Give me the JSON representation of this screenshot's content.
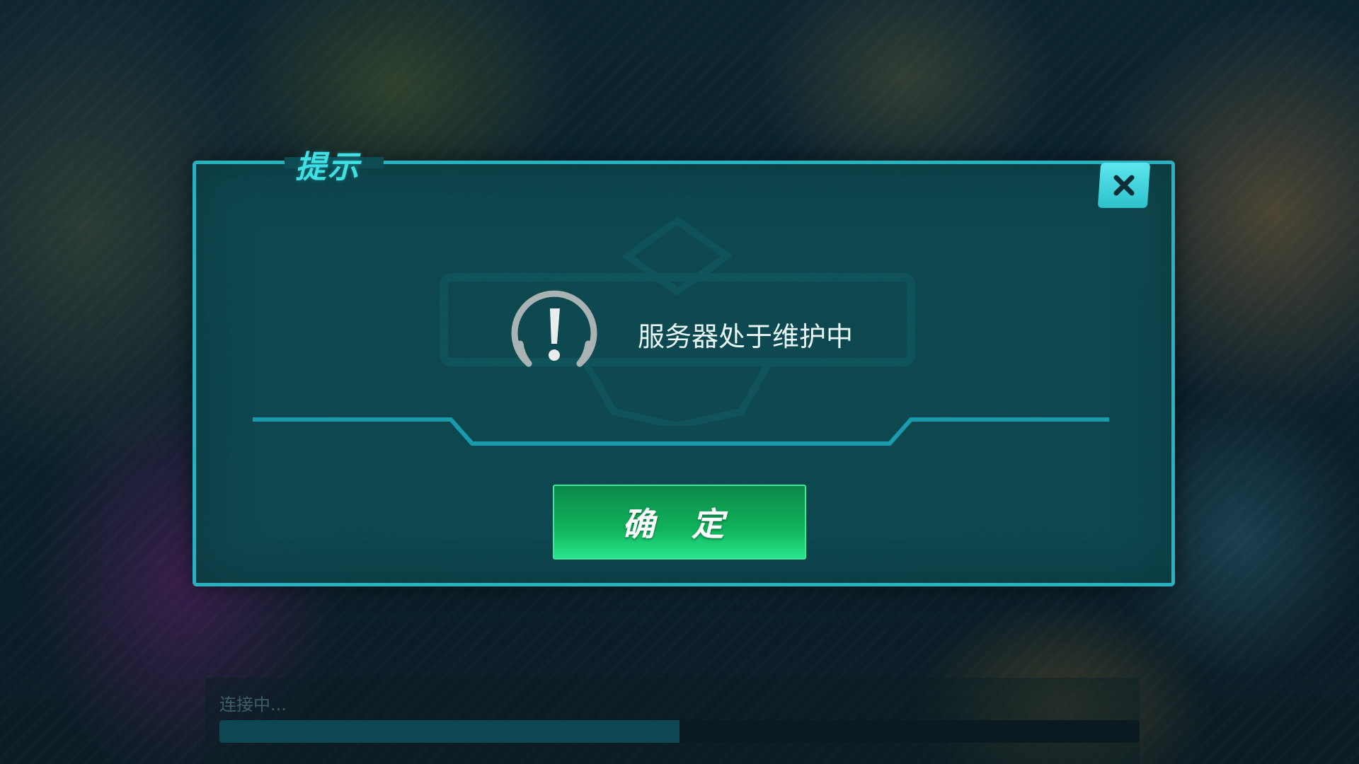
{
  "dialog": {
    "title": "提示",
    "message": "服务器处于维护中",
    "confirm_label": "确 定",
    "close_icon": "close-icon",
    "warning_icon": "exclamation-circle-icon"
  },
  "loading": {
    "status_text": "连接中...",
    "progress": 0.5
  },
  "colors": {
    "accent": "#2ab1c0",
    "title": "#3fe0e4",
    "confirm_button": "#10b35c",
    "dialog_bg": "#0e4a52",
    "progress_fill": "#0c4752"
  }
}
